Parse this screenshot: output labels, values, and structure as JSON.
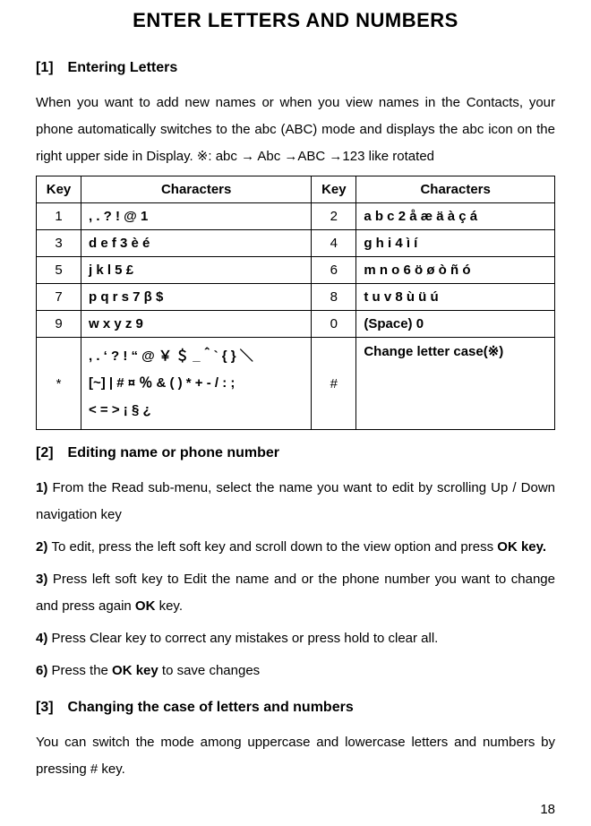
{
  "title": "ENTER LETTERS AND NUMBERS",
  "s1": {
    "heading": "[1] Entering Letters",
    "para": "When you want to add new names or when you view names in the Contacts, your phone automatically switches to the abc (ABC) mode and displays the abc icon on the right upper side in Display.  ※: abc → Abc →ABC →123 like rotated"
  },
  "table": {
    "hdr": {
      "key": "Key",
      "chars": "Characters"
    },
    "k1": "1",
    "c1": ", . ? ! @  1",
    "k2": "2",
    "c2": "a b c 2 å æ ä à ç á",
    "k3": "3",
    "c3": "d e f 3 è é",
    "k4": "4",
    "c4": "g h i 4 ì í",
    "k5": "5",
    "c5": "j k l 5 £",
    "k6": "6",
    "c6": "m n o 6 ö ø ò ñ ó",
    "k7": "7",
    "c7": "p q r s 7 β $",
    "k8": "8",
    "c8": "t u v 8 ù ü ú",
    "k9": "9",
    "c9": "w x y z 9",
    "k0": "0",
    "c0": "(Space) 0",
    "kstar": "*",
    "cstar_l1": ", . ‘ ? ! “ @ ￥ ＄ _＾` { } ＼",
    "cstar_l2": "[~] | # ¤ ％ & ( ) * + - / : ;",
    "cstar_l3": "< = > ¡ § ¿",
    "khash": "#",
    "chash": "Change letter case(※)"
  },
  "s2": {
    "heading": "[2] Editing name or phone number",
    "p1a": "1) ",
    "p1b": "From the Read sub-menu, select the name you want to edit by scrolling Up / Down navigation key",
    "p2a": "2) ",
    "p2b": "To edit, press the left soft key and scroll down to the view option and press ",
    "p2c": "OK key.",
    "p3a": "3) ",
    "p3b": "Press left soft key to Edit the name and or the phone number you want to change and press again ",
    "p3c": "OK",
    "p3d": " key.",
    "p4a": "4) ",
    "p4b": "Press Clear key to correct any mistakes or press hold to clear all.",
    "p6a": "6) ",
    "p6b": "Press the ",
    "p6c": "OK key",
    "p6d": " to save changes"
  },
  "s3": {
    "heading": "[3] Changing the case of letters and numbers",
    "para": "You can switch the mode among uppercase and lowercase letters and numbers by pressing # key."
  },
  "page_number": "18"
}
